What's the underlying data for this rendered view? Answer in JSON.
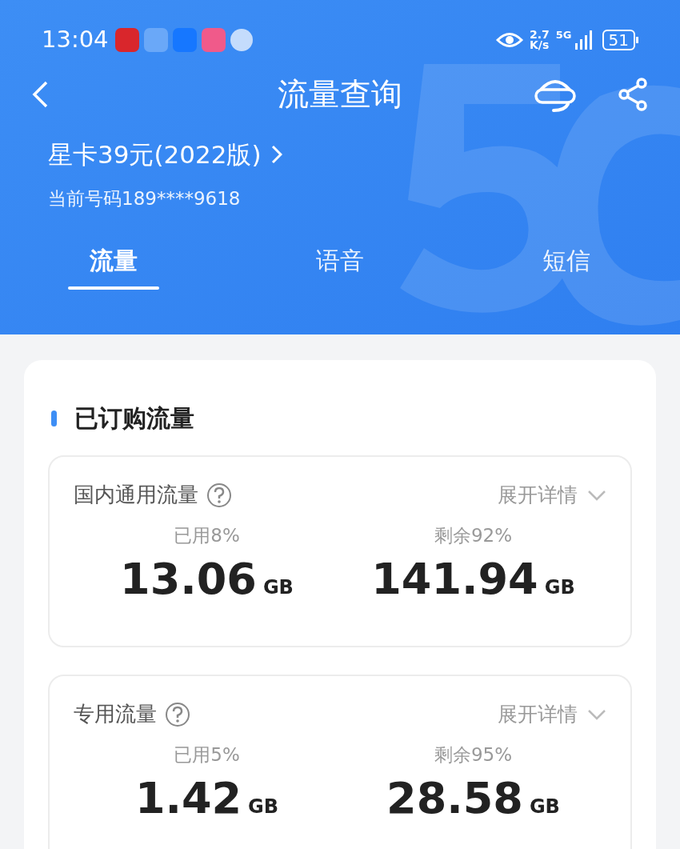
{
  "status_bar": {
    "time": "13:04",
    "net_speed": "2.7",
    "net_speed_unit": "K/s",
    "network": "5G",
    "battery": "51"
  },
  "header": {
    "title": "流量查询",
    "plan": "星卡39元(2022版)",
    "number": "当前号码189****9618"
  },
  "tabs": [
    {
      "label": "流量",
      "selected": true
    },
    {
      "label": "语音",
      "selected": false
    },
    {
      "label": "短信",
      "selected": false
    }
  ],
  "section": {
    "title": "已订购流量",
    "cards": [
      {
        "title": "国内通用流量",
        "toggle": "展开详情",
        "used_label": "已用8%",
        "used": "13.06",
        "used_unit": "GB",
        "remain_label": "剩余92%",
        "remain": "141.94",
        "remain_unit": "GB"
      },
      {
        "title": "专用流量",
        "toggle": "展开详情",
        "used_label": "已用5%",
        "used": "1.42",
        "used_unit": "GB",
        "remain_label": "剩余95%",
        "remain": "28.58",
        "remain_unit": "GB"
      }
    ]
  }
}
